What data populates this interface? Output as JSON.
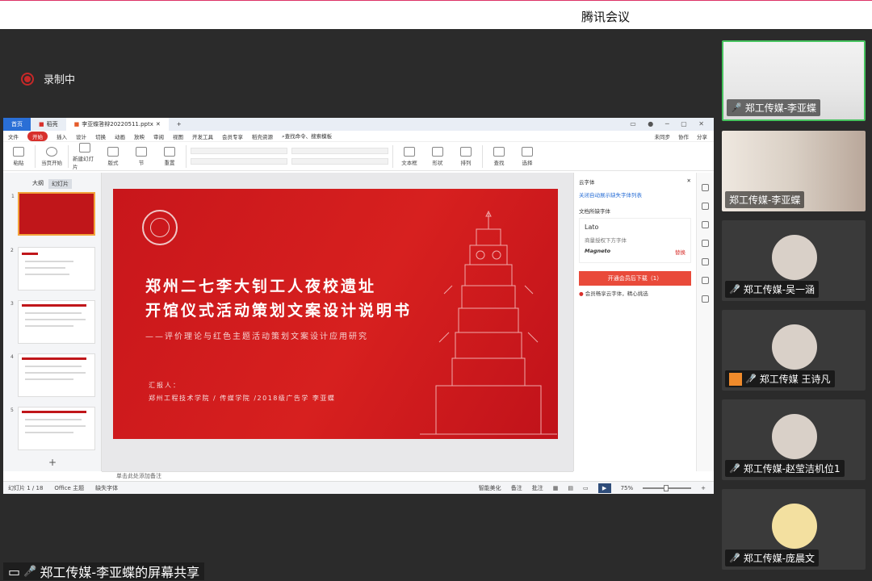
{
  "app": {
    "title": "腾讯会议"
  },
  "recording": {
    "label": "录制中"
  },
  "share": {
    "label": "郑工传媒-李亚蝶的屏幕共享",
    "tabs": [
      {
        "label": "首页"
      },
      {
        "label": "稻壳"
      },
      {
        "label": "李亚蝶答辩20220511.pptx"
      }
    ],
    "menu": [
      "文件",
      "开始",
      "插入",
      "设计",
      "切换",
      "动画",
      "放映",
      "审阅",
      "视图",
      "开发工具",
      "会员专享",
      "稻壳资源"
    ],
    "menu_search": "查找命令、搜索模板",
    "menu_right": [
      "未同步",
      "协作",
      "分享"
    ],
    "ribbon": {
      "paste": "粘贴",
      "play": "当页开始",
      "new_slide": "新建幻灯片",
      "layout": "版式",
      "section": "节",
      "textbox": "文本框",
      "shape": "形状",
      "arrange": "排列",
      "find": "查找",
      "select": "选择",
      "reset": "重置"
    },
    "left_tabs": [
      "大纲",
      "幻灯片"
    ],
    "slide_nums": [
      "1",
      "2",
      "3",
      "4",
      "5"
    ],
    "slide": {
      "title_line1": "郑州二七李大钊工人夜校遗址",
      "title_line2": "开馆仪式活动策划文案设计说明书",
      "subtitle": "——评价理论与红色主题活动策划文案设计应用研究",
      "reporter": "汇报人：",
      "org": "郑州工程技术学院  /  传媒学院  /2018级广告学   李亚蝶"
    },
    "notes": "单击此处添加备注",
    "right_pane": {
      "header": "云字体",
      "link": "关闭自动展示缺失字体列表",
      "section": "文档所缺字体",
      "font_name": "Lato",
      "font_desc": "商量授权下方字体",
      "font_sample": "Magneto",
      "font_action": "替换",
      "download": "开通会员后下载（1）",
      "note": "会员畅享云字体，精心挑选"
    },
    "status": {
      "slide": "幻灯片 1 / 18",
      "theme": "Office 主题",
      "font": "缺失字体",
      "beautify": "智能美化",
      "notes": "备注",
      "comments": "批注",
      "zoom": "75%"
    }
  },
  "participants": [
    {
      "name": "郑工传媒-李亚蝶",
      "mic": "on"
    },
    {
      "name": "郑工传媒-李亚蝶",
      "mic": "none"
    },
    {
      "name": "郑工传媒-吴一涵",
      "mic": "muted"
    },
    {
      "name": "郑工传媒 王诗凡",
      "mic": "muted"
    },
    {
      "name": "郑工传媒-赵莹洁机位1",
      "mic": "muted"
    },
    {
      "name": "郑工传媒-庞晨文",
      "mic": "muted"
    }
  ],
  "colors": {
    "accent_green": "#46c35e",
    "slide_red": "#d7201f",
    "wps_red": "#d8302c"
  }
}
